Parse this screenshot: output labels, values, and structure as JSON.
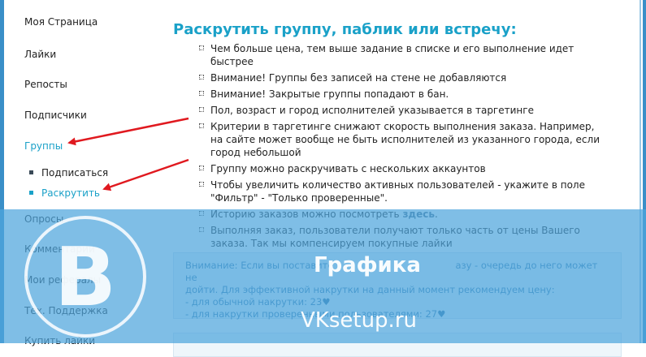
{
  "sidebar": {
    "items": [
      {
        "label": "Моя Страница"
      },
      {
        "label": "Лайки"
      },
      {
        "label": "Репосты"
      },
      {
        "label": "Подписчики"
      },
      {
        "label": "Группы"
      },
      {
        "label": "Опросы"
      },
      {
        "label": "Комментарии"
      },
      {
        "label": "Мои рефералы"
      },
      {
        "label": "Тех. Поддержка"
      },
      {
        "label": "Купить лайки"
      }
    ],
    "sub_items": [
      {
        "label": "Подписаться"
      },
      {
        "label": "Раскрутить"
      }
    ],
    "active_color": "#1aa1c8"
  },
  "main": {
    "title": "Раскрутить группу, паблик или встречу:",
    "tips": [
      "Чем больше цена, тем выше задание в списке и его выполнение идет быстрее",
      "Внимание! Группы без записей на стене не добавляются",
      "Внимание! Закрытые группы попадают в бан.",
      "Пол, возраст и город исполнителей указывается в таргетинге",
      "Критерии в таргетинге снижают скорость выполнения заказа. Например, на сайте может вообще не быть исполнителей из указанного города, если город небольшой",
      "Группу можно раскручивать с нескольких аккаунтов",
      "Чтобы увеличить количество активных пользователей - укажите в поле \"Фильтр\" - \"Только проверенные\".",
      "Историю заказов можно посмотреть",
      "Выполняя заказ, пользователи получают только часть от цены Вашего заказа. Так мы компенсируем покупные лайки"
    ],
    "history_link": "здесь",
    "history_suffix": ".",
    "notice": {
      "line1": "Внимание: Если вы поставите",
      "line1_end": "азу - очередь до него может не",
      "line2": "дойти. Для эффективной накрутки на данный момент рекомендуем цену:",
      "line3": "- для обычной накрутки: 23",
      "line4": "- для накрутки проверенными пользователями: 27",
      "heart": "♥"
    }
  },
  "watermark": {
    "logo_letter": "B",
    "title": "Графика",
    "site": "VKsetup.ru"
  },
  "colors": {
    "accent": "#1aa1c8",
    "arrow": "#e0191f",
    "overlay": "#4ea5dc"
  }
}
